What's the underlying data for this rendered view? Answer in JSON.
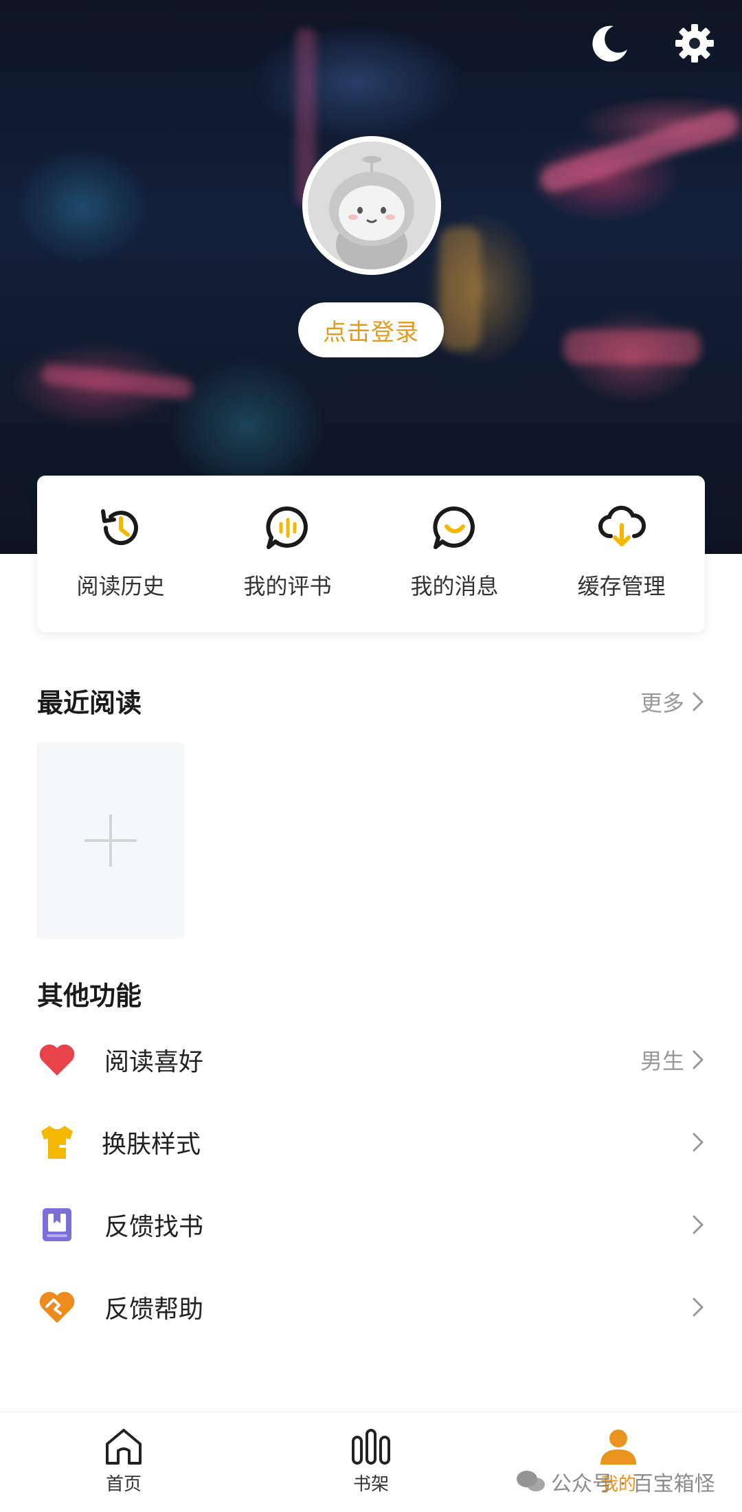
{
  "header": {
    "login_label": "点击登录",
    "icons": [
      "moon-icon",
      "gear-icon"
    ]
  },
  "quick_actions": [
    {
      "label": "阅读历史",
      "icon": "history-clock-icon"
    },
    {
      "label": "我的评书",
      "icon": "comment-bars-icon"
    },
    {
      "label": "我的消息",
      "icon": "message-smile-icon"
    },
    {
      "label": "缓存管理",
      "icon": "cloud-download-icon"
    }
  ],
  "recent": {
    "title": "最近阅读",
    "more_label": "更多"
  },
  "other": {
    "title": "其他功能",
    "items": [
      {
        "label": "阅读喜好",
        "value": "男生",
        "icon": "heart-icon"
      },
      {
        "label": "换肤样式",
        "value": "",
        "icon": "tshirt-icon"
      },
      {
        "label": "反馈找书",
        "value": "",
        "icon": "book-icon"
      },
      {
        "label": "反馈帮助",
        "value": "",
        "icon": "help-heart-icon"
      }
    ]
  },
  "nav": {
    "items": [
      {
        "label": "首页",
        "icon": "home-icon"
      },
      {
        "label": "书架",
        "icon": "bookshelf-icon"
      },
      {
        "label": "我的",
        "icon": "person-icon"
      }
    ],
    "active": "我的"
  },
  "watermark": "公众号 · 百宝箱怪",
  "colors": {
    "accent": "#e8941f",
    "login_text": "#e49a1d",
    "heart": "#e8434a",
    "tshirt": "#f5b800",
    "book": "#7b6fd8",
    "help": "#ef8a1c"
  }
}
